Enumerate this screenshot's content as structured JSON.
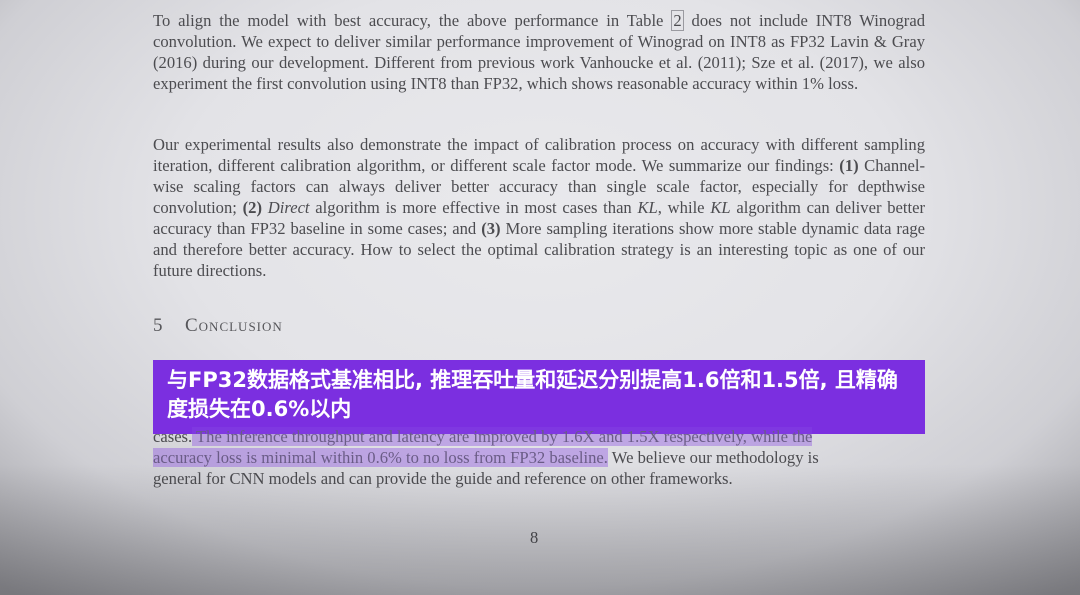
{
  "paragraph1": {
    "part1": "To align the model with best accuracy, the above performance in Table ",
    "table_ref": "2",
    "part2": " does not include INT8 Winograd convolution. We expect to deliver similar performance improvement of Winograd on INT8 as FP32 Lavin & Gray (2016) during our development. Different from previous work Vanhoucke et al. (2011); Sze et al. (2017), we also experiment the first convolution using INT8 than FP32, which shows reasonable accuracy within 1% loss."
  },
  "paragraph2": {
    "t1": "Our experimental results also demonstrate the impact of calibration process on accuracy with different sampling iteration, different calibration algorithm, or different scale factor mode. We summarize our findings: ",
    "n1": "(1)",
    "t2": " Channel-wise scaling factors can always deliver better accuracy than single scale factor, especially for depthwise convolution; ",
    "n2": "(2)",
    "i1": "Direct",
    "t3": " algorithm is more effective in most cases than ",
    "i2": "KL",
    "t4": ", while ",
    "i3": "KL",
    "t5": " algorithm can deliver better accuracy than FP32 baseline in some cases; and ",
    "n3": "(3)",
    "t6": " More sampling iterations show more stable dynamic data rage and therefore better accuracy. How to select the optimal calibration strategy is an interesting topic as one of our future directions."
  },
  "section": {
    "number": "5",
    "title": "Conclusion"
  },
  "banner": {
    "line1": "与FP32数据格式基准相比, 推理吞吐量和延迟分别提高1.6倍和1.5倍, 且精确",
    "line2": "度损失在0.6%以内"
  },
  "paragraph3": {
    "line1_plain": "cases.",
    "line1_highlight": " The inference throughput and latency are improved by 1.6X and 1.5X respectively, while the",
    "line2_highlight": "accuracy loss is minimal within 0.6% to no loss from FP32 baseline.",
    "line2_plain": " We believe our methodology is",
    "line3": "general for CNN models and can provide the guide and reference on other frameworks."
  },
  "page_number": "8",
  "colors": {
    "banner": "#7b2fe0",
    "highlight": "#8746e1"
  }
}
